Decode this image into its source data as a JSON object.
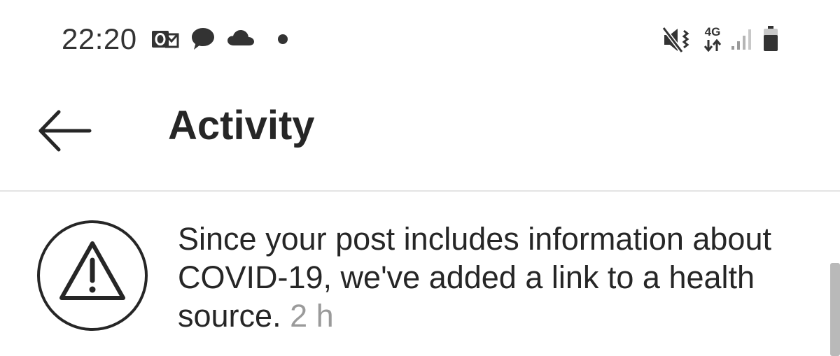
{
  "status_bar": {
    "time": "22:20",
    "left_icons": [
      "outlook-icon",
      "chat-bubble-icon",
      "cloud-icon",
      "notification-dot-icon"
    ],
    "right_icons": [
      "vibrate-mute-icon",
      "network-4g-icon",
      "signal-strength-icon",
      "battery-icon"
    ],
    "network_type": "4G"
  },
  "app_bar": {
    "back_icon": "arrow-left-icon",
    "title": "Activity"
  },
  "notifications": [
    {
      "icon": "warning-triangle-icon",
      "message": "Since your post includes information about COVID-19, we've added a link to a health source.",
      "time": "2 h"
    }
  ],
  "colors": {
    "text_primary": "#262626",
    "text_secondary": "#9a9a9a",
    "divider": "#e4e4e4",
    "background": "#ffffff",
    "scrollbar": "#b9b9b9"
  }
}
